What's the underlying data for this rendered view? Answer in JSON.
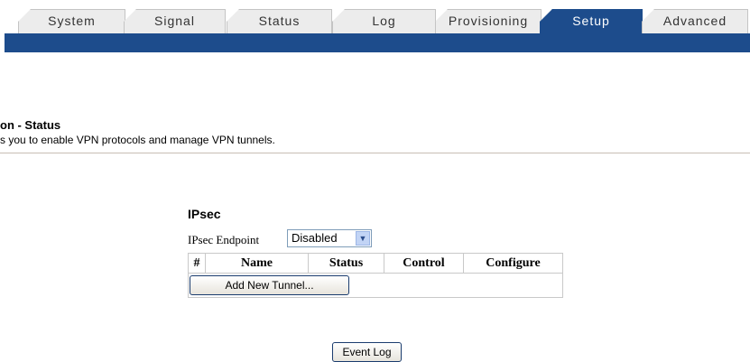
{
  "tabs": [
    {
      "label": "System",
      "active": false
    },
    {
      "label": "Signal",
      "active": false
    },
    {
      "label": "Status",
      "active": false
    },
    {
      "label": "Log",
      "active": false
    },
    {
      "label": "Provisioning",
      "active": false
    },
    {
      "label": "Setup",
      "active": true
    },
    {
      "label": "Advanced",
      "active": false
    }
  ],
  "colors": {
    "banner": "#1d4c8c",
    "active_tab": "#1d4c8c",
    "divider": "#c8beb4"
  },
  "page": {
    "title": "on - Status",
    "subtitle": "s you to enable VPN protocols and manage VPN tunnels."
  },
  "ipsec": {
    "heading": "IPsec",
    "endpoint_label": "IPsec Endpoint",
    "endpoint_value": "Disabled",
    "table_headers": [
      "#",
      "Name",
      "Status",
      "Control",
      "Configure"
    ],
    "add_button": "Add New Tunnel..."
  },
  "footer": {
    "event_log_button": "Event Log"
  }
}
